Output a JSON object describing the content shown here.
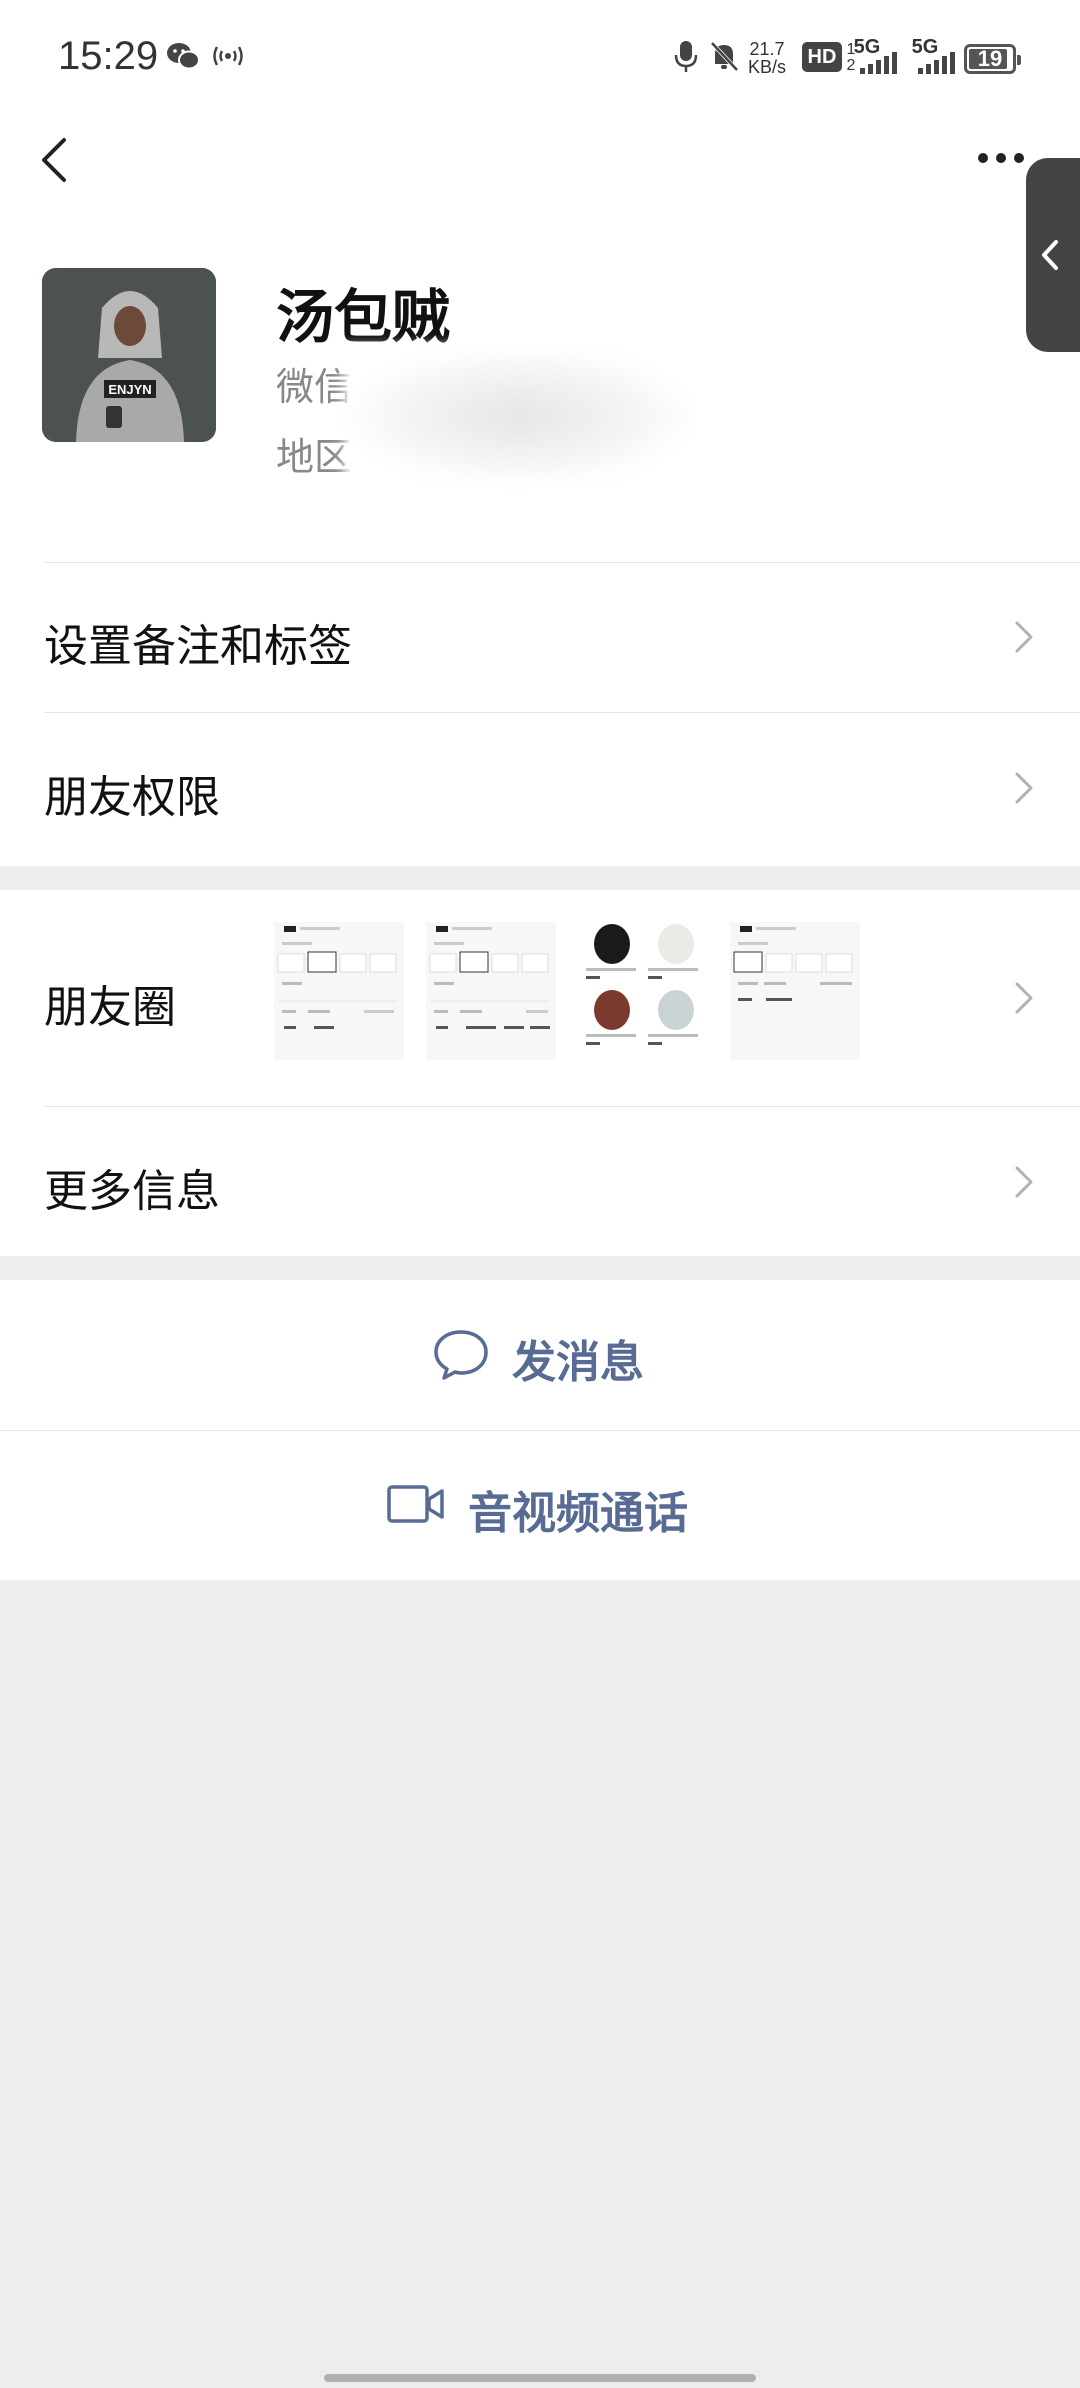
{
  "status_bar": {
    "time": "15:29",
    "network_speed_value": "21.7",
    "network_speed_unit": "KB/s",
    "hd_label": "HD",
    "sim1_label": "5G",
    "sim2_label": "5G",
    "battery": "19",
    "icons": [
      "wechat-icon",
      "hotspot-icon",
      "mic-icon",
      "mute-icon",
      "hd-icon",
      "signal-icon",
      "signal-icon",
      "battery-icon"
    ]
  },
  "header": {
    "nickname": "汤包贼",
    "wechat_id_label": "微信",
    "region_label": "地区：東埔"
  },
  "menu": {
    "remark_tags": "设置备注和标签",
    "friend_permissions": "朋友权限",
    "moments": "朋友圈",
    "more_info": "更多信息"
  },
  "actions": {
    "send_message": "发消息",
    "av_call": "音视频通话"
  },
  "colors": {
    "link_blue": "#576b95",
    "page_bg": "#ededed"
  }
}
